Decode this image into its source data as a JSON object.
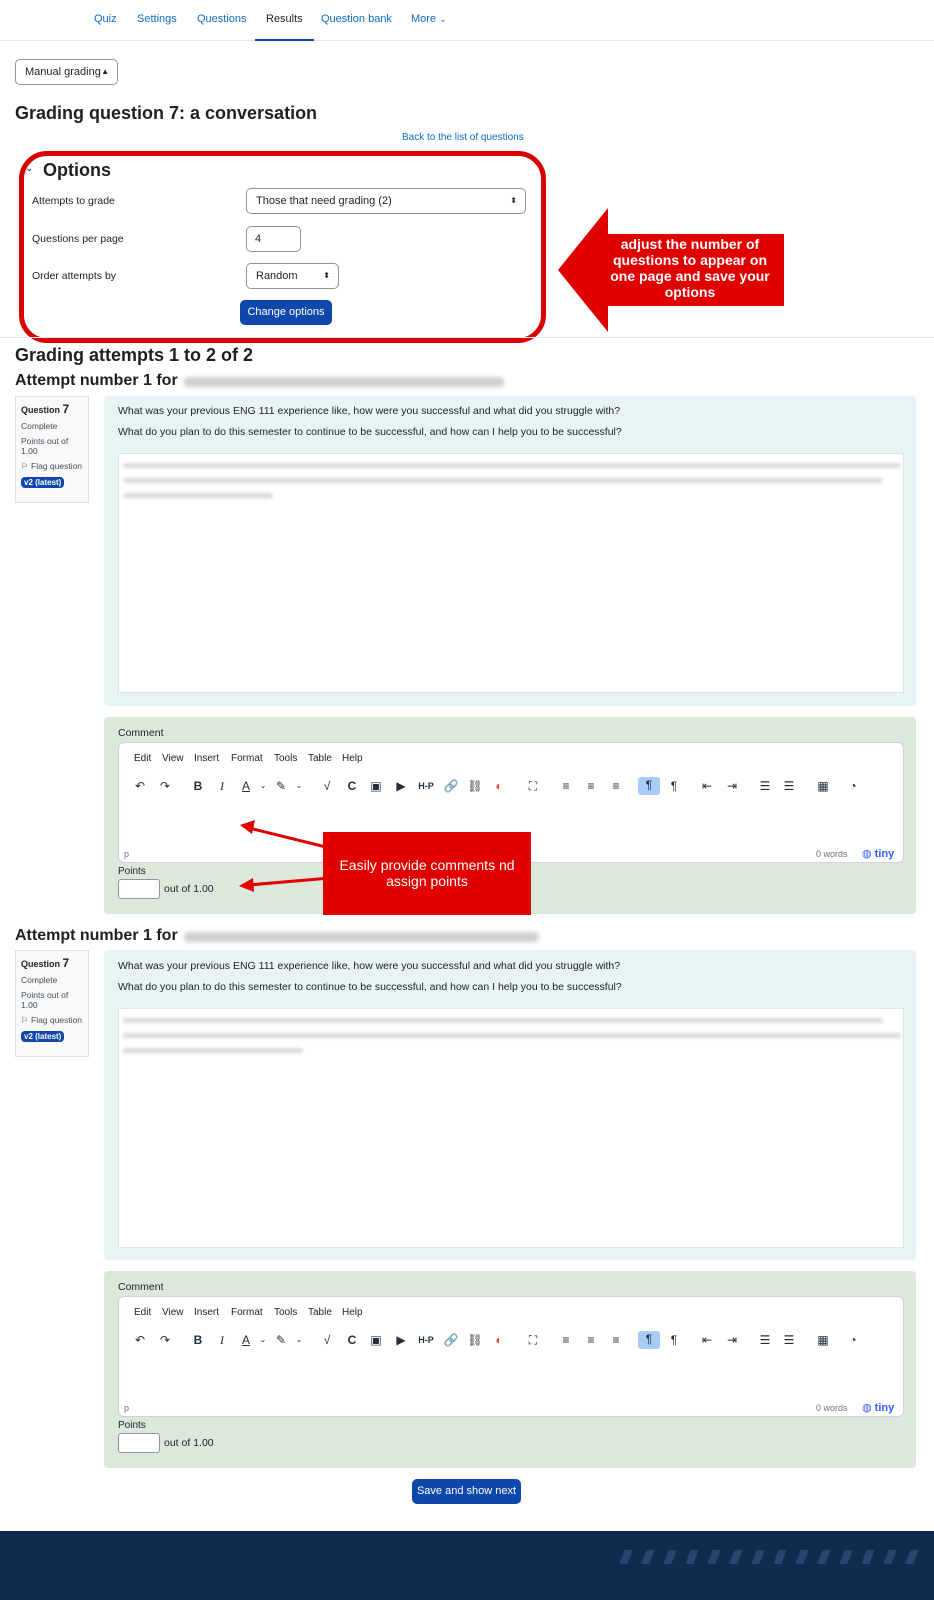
{
  "nav": {
    "items": [
      "Quiz",
      "Settings",
      "Questions",
      "Results",
      "Question bank",
      "More"
    ],
    "active": "Results",
    "more_chevron": "⌄"
  },
  "grading_mode": "Manual grading",
  "page_title": "Grading question 7: a conversation",
  "back_link": "Back to the list of questions",
  "options": {
    "heading": "Options",
    "attempts_label": "Attempts to grade",
    "attempts_value": "Those that need grading (2)",
    "per_page_label": "Questions per page",
    "per_page_value": "4",
    "order_label": "Order attempts by",
    "order_value": "Random",
    "change_button": "Change options"
  },
  "callouts": {
    "options_note": "adjust the number of questions to appear on one page and save your options",
    "comment_note": "Easily provide comments nd assign points"
  },
  "grading_heading": "Grading attempts 1 to 2 of 2",
  "attempts": [
    {
      "title": "Attempt number 1 for",
      "info": {
        "question_word": "Question",
        "question_number": "7",
        "state": "Complete",
        "points": "Points out of 1.00",
        "flag": "Flag question",
        "version": "v2 (latest)"
      },
      "q1": "What was your previous ENG 111 experience like, how were you successful and what did you struggle with?",
      "q2": "What do you plan to do this semester to continue to be successful, and how can I help you to be successful?",
      "comment_label": "Comment",
      "points_label": "Points",
      "out_of": "out of 1.00"
    },
    {
      "title": "Attempt number 1 for",
      "info": {
        "question_word": "Question",
        "question_number": "7",
        "state": "Complete",
        "points": "Points out of 1.00",
        "flag": "Flag question",
        "version": "v2 (latest)"
      },
      "q1": "What was your previous ENG 111 experience like, how were you successful and what did you struggle with?",
      "q2": "What do you plan to do this semester to continue to be successful, and how can I help you to be successful?",
      "comment_label": "Comment",
      "points_label": "Points",
      "out_of": "out of 1.00"
    }
  ],
  "editor": {
    "menu": [
      "Edit",
      "View",
      "Insert",
      "Format",
      "Tools",
      "Table",
      "Help"
    ],
    "status_tag": "p",
    "word_count": "0 words",
    "brand": "tiny"
  },
  "save_button": "Save and show next"
}
